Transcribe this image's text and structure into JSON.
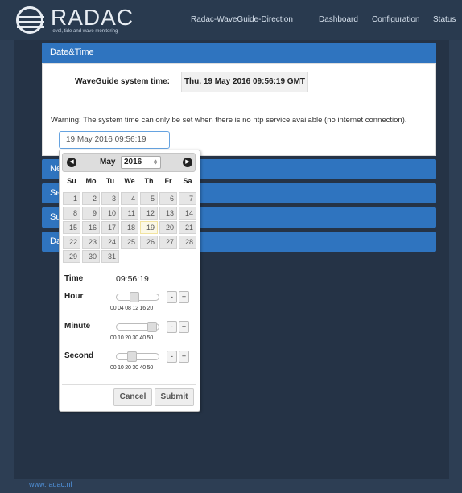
{
  "header": {
    "logo_text": "RADAC",
    "logo_tagline": "level, tide and wave monitoring",
    "nav": [
      "Radac-WaveGuide-Direction",
      "Dashboard",
      "Configuration",
      "Status"
    ]
  },
  "panels": {
    "datetime_title": "Date&Time",
    "collapsed": [
      {
        "label": "Ne"
      },
      {
        "label": "Se"
      },
      {
        "label": "Su"
      },
      {
        "label": "Da"
      }
    ]
  },
  "datetime": {
    "system_time_label": "WaveGuide system time:",
    "system_time_value": "Thu, 19 May 2016 09:56:19 GMT",
    "warning": "Warning: The system time can only be set when there is no ntp service available (no internet connection).",
    "input_value": "19 May 2016 09:56:19"
  },
  "datepicker": {
    "prev_icon": "◀",
    "next_icon": "▶",
    "month": "May",
    "year": "2016",
    "weekdays": [
      "Su",
      "Mo",
      "Tu",
      "We",
      "Th",
      "Fr",
      "Sa"
    ],
    "days": [
      [
        "1",
        "2",
        "3",
        "4",
        "5",
        "6",
        "7"
      ],
      [
        "8",
        "9",
        "10",
        "11",
        "12",
        "13",
        "14"
      ],
      [
        "15",
        "16",
        "17",
        "18",
        "19",
        "20",
        "21"
      ],
      [
        "22",
        "23",
        "24",
        "25",
        "26",
        "27",
        "28"
      ],
      [
        "29",
        "30",
        "31"
      ]
    ],
    "today": "19",
    "time_label": "Time",
    "time_value": "09:56:19",
    "hour_label": "Hour",
    "hour_ticks": "00 04 08 12 16 20",
    "hour_level": 0.41,
    "minute_label": "Minute",
    "minute_ticks": "00 10 20 30 40 50",
    "minute_level": 0.95,
    "second_label": "Second",
    "second_ticks": "00 10 20 30 40 50",
    "second_level": 0.32,
    "minus": "-",
    "plus": "+",
    "cancel": "Cancel",
    "submit": "Submit"
  },
  "footer": {
    "link": "www.radac.nl"
  },
  "colors": {
    "panel_header": "#2f74bf",
    "background": "#2d3e54",
    "today_highlight": "#fbf8e6"
  }
}
